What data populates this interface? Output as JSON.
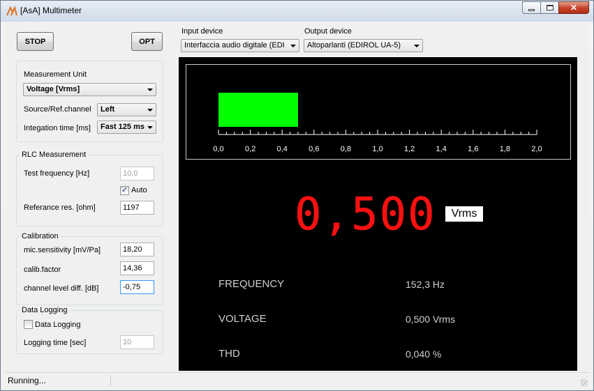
{
  "window": {
    "title": "[AsA] Multimeter",
    "minimize_icon": "minimize-icon",
    "maximize_icon": "maximize-icon",
    "close_icon": "close-icon"
  },
  "toolbar": {
    "stop_label": "STOP",
    "opt_label": "OPT"
  },
  "devices": {
    "input_label": "Input device",
    "input_value": "Interfaccia audio digitale (EDI",
    "output_label": "Output device",
    "output_value": "Altoparlanti (EDIROL UA-5)"
  },
  "measurement": {
    "unit_label": "Measurement  Unit",
    "unit_value": "Voltage  [Vrms]",
    "source_label": "Source/Ref.channel",
    "source_value": "Left",
    "integration_label": "Integation time [ms]",
    "integration_value": "Fast 125 ms"
  },
  "rlc": {
    "title": "RLC Measurement",
    "test_freq_label": "Test frequency [Hz]",
    "test_freq_value": "10,0",
    "auto_label": "Auto",
    "auto_checked": true,
    "ref_res_label": "Referance  res. [ohm]",
    "ref_res_value": "1197"
  },
  "calibration": {
    "title": "Calibration",
    "mic_label": "mic.sensitivity [mV/Pa]",
    "mic_value": "18,20",
    "calib_label": "calib.factor",
    "calib_value": "14,36",
    "level_label": "channel level diff. [dB]",
    "level_value": "-0,75"
  },
  "logging": {
    "title": "Data Logging",
    "check_label": "Data Logging",
    "checked": false,
    "time_label": "Logging time [sec]",
    "time_value": "10"
  },
  "display": {
    "bar_color": "#00ff00",
    "bar_level": 0.5,
    "scale_max": 2.0,
    "scale_labels": [
      "0,0",
      "0,2",
      "0,4",
      "0,6",
      "0,8",
      "1,0",
      "1,2",
      "1,4",
      "1,6",
      "1,8",
      "2,0"
    ],
    "main_value": "0,500",
    "main_unit": "Vrms",
    "value_color": "#ff1010",
    "rows": [
      {
        "label": "FREQUENCY",
        "value": "152,3  Hz"
      },
      {
        "label": "VOLTAGE",
        "value": "0,500  Vrms"
      },
      {
        "label": "THD",
        "value": "0,040  %"
      }
    ]
  },
  "status": {
    "text": "Running..."
  }
}
